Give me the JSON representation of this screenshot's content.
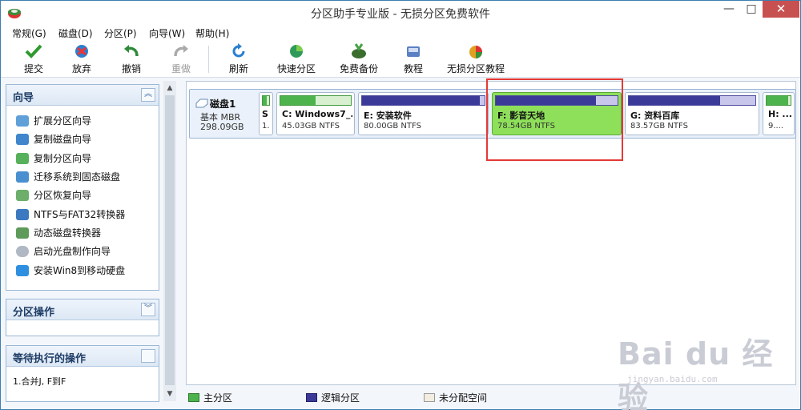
{
  "window": {
    "title": "分区助手专业版 - 无损分区免费软件",
    "min_symbol": "—",
    "max_symbol": "□",
    "close_symbol": "✕"
  },
  "menu": [
    "常规(G)",
    "磁盘(D)",
    "分区(P)",
    "向导(W)",
    "帮助(H)"
  ],
  "toolbar": {
    "commit": "提交",
    "discard": "放弃",
    "undo": "撤销",
    "redo": "重做",
    "refresh": "刷新",
    "quick_partition": "快速分区",
    "free_backup": "免费备份",
    "tutorial": "教程",
    "lossless_tutorial": "无损分区教程"
  },
  "sidebar": {
    "wizard_title": "向导",
    "wizard_items": [
      "扩展分区向导",
      "复制磁盘向导",
      "复制分区向导",
      "迁移系统到固态磁盘",
      "分区恢复向导",
      "NTFS与FAT32转换器",
      "动态磁盘转换器",
      "启动光盘制作向导",
      "安装Win8到移动硬盘"
    ],
    "partition_ops_title": "分区操作",
    "pending_title": "等待执行的操作",
    "pending_items": [
      "1.合并J, F到F"
    ]
  },
  "disk": {
    "name": "磁盘1",
    "type": "基本 MBR",
    "size": "298.09GB",
    "partitions": [
      {
        "name": "S",
        "size": "1.",
        "kind": "primary",
        "used": 0.6
      },
      {
        "name": "C: Windows7_...",
        "size": "45.03GB NTFS",
        "kind": "primary",
        "used": 0.5
      },
      {
        "name": "E: 安装软件",
        "size": "80.00GB NTFS",
        "kind": "logical",
        "used": 0.96
      },
      {
        "name": "F: 影音天地",
        "size": "78.54GB NTFS",
        "kind": "logical",
        "used": 0.82
      },
      {
        "name": "G: 资料百库",
        "size": "83.57GB NTFS",
        "kind": "logical",
        "used": 0.72
      },
      {
        "name": "H: ...",
        "size": "9....",
        "kind": "primary",
        "used": 0.9
      }
    ]
  },
  "legend": {
    "primary": "主分区",
    "logical": "逻辑分区",
    "unallocated": "未分配空间"
  },
  "colors": {
    "primary_fill": "#4db34d",
    "logical_fill": "#3c3a98",
    "selected_partition": "#8ee05a",
    "highlight": "#e53935"
  },
  "watermark": {
    "main": "Bai du 经验",
    "sub": "jingyan.baidu.com"
  }
}
